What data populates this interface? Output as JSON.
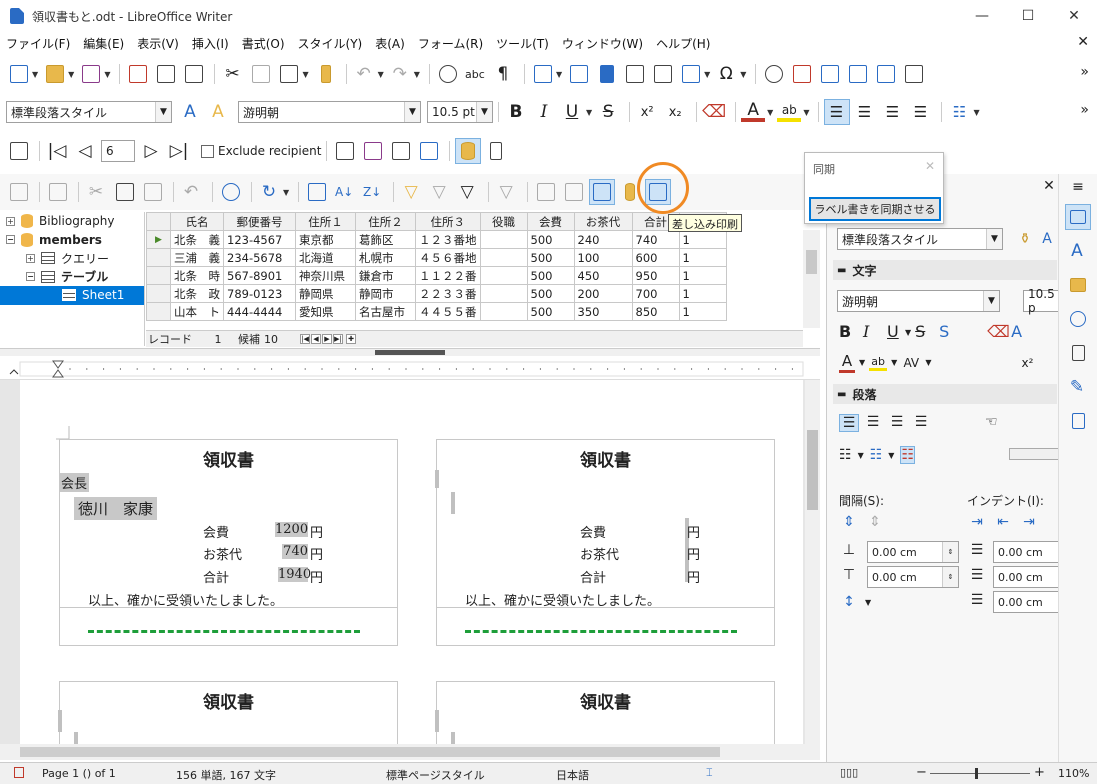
{
  "window": {
    "title": "領収書もと.odt - LibreOffice Writer",
    "minimize": "—",
    "maximize": "☐",
    "close": "✕"
  },
  "menu": [
    "ファイル(F)",
    "編集(E)",
    "表示(V)",
    "挿入(I)",
    "書式(O)",
    "スタイル(Y)",
    "表(A)",
    "フォーム(R)",
    "ツール(T)",
    "ウィンドウ(W)",
    "ヘルプ(H)"
  ],
  "menu_close": "✕",
  "toolbar2": {
    "paragraph_style": "標準段落スタイル",
    "font_name": "游明朝",
    "font_size": "10.5 pt",
    "bold": "B",
    "italic": "I",
    "underline": "U",
    "strike": "S",
    "superscript": "x²",
    "subscript": "x₂"
  },
  "mailmerge": {
    "record": "6",
    "exclude_recipient": "Exclude recipient"
  },
  "tooltip": "差し込み印刷",
  "popup": {
    "title": "同期",
    "button": "ラベル書きを同期させる"
  },
  "datasource_tree": [
    {
      "label": "Bibliography",
      "expander": "+",
      "type": "db",
      "indent": 0
    },
    {
      "label": "members",
      "expander": "−",
      "type": "db",
      "indent": 0,
      "bold": true
    },
    {
      "label": "クエリー",
      "expander": "+",
      "type": "folder",
      "indent": 1
    },
    {
      "label": "テーブル",
      "expander": "−",
      "type": "folder",
      "indent": 1,
      "bold": true
    },
    {
      "label": "Sheet1",
      "expander": "",
      "type": "table",
      "indent": 2,
      "selected": true
    }
  ],
  "grid": {
    "headers": [
      "氏名",
      "郵便番号",
      "住所１",
      "住所２",
      "住所３",
      "役職",
      "会費",
      "お茶代",
      "合計",
      ""
    ],
    "rows": [
      [
        "北条　義",
        "123-4567",
        "東京都",
        "葛飾区",
        "１２３番地",
        "",
        "500",
        "240",
        "740",
        "1"
      ],
      [
        "三浦　義",
        "234-5678",
        "北海道",
        "札幌市",
        "４５６番地",
        "",
        "500",
        "100",
        "600",
        "1"
      ],
      [
        "北条　時",
        "567-8901",
        "神奈川県",
        "鎌倉市",
        "１１２２番",
        "",
        "500",
        "450",
        "950",
        "1"
      ],
      [
        "北条　政",
        "789-0123",
        "静岡県",
        "静岡市",
        "２２３３番",
        "",
        "500",
        "200",
        "700",
        "1"
      ],
      [
        "山本　ト",
        "444-4444",
        "愛知県",
        "名古屋市",
        "４４５５番",
        "",
        "500",
        "350",
        "850",
        "1"
      ]
    ],
    "current_row_marker": "▶"
  },
  "record_bar": {
    "label": "レコード",
    "current": "1",
    "of_label": "候補",
    "total": "10"
  },
  "labels": [
    {
      "title": "領収書",
      "position_title": "会長",
      "name": "徳川　家康",
      "rows": [
        [
          "会費",
          "1200",
          "円"
        ],
        [
          "お茶代",
          "740",
          "円"
        ],
        [
          "合計",
          "1940",
          "円"
        ]
      ],
      "closing": "以上、確かに受領いたしました。"
    },
    {
      "title": "領収書",
      "position_title": "",
      "name": "",
      "rows": [
        [
          "会費",
          "",
          "円"
        ],
        [
          "お茶代",
          "",
          "円"
        ],
        [
          "合計",
          "",
          "円"
        ]
      ],
      "closing": "以上、確かに受領いたしました。"
    },
    {
      "title": "領収書"
    },
    {
      "title": "領収書"
    }
  ],
  "sidebar": {
    "close": "✕",
    "menu": "≡",
    "para_style": "標準段落スタイル",
    "char_section": "文字",
    "font": "游明朝",
    "font_size": "10.5 p",
    "para_section": "段落",
    "spacing_label": "間隔(S):",
    "indent_label": "インデント(I):",
    "spacing_above": "0.00 cm",
    "spacing_below": "0.00 cm",
    "indent_before": "0.00 cm",
    "indent_after": "0.00 cm",
    "indent_first": "0.00 cm"
  },
  "status": {
    "page": "Page 1 () of 1",
    "words": "156 単語, 167 文字",
    "page_style": "標準ページスタイル",
    "language": "日本語",
    "zoom": "110%"
  },
  "colors": {
    "accent": "#0078d7",
    "highlight_circle": "#f08a24",
    "dash_green": "#1e9e3a",
    "app_blue": "#2a6bc4"
  }
}
